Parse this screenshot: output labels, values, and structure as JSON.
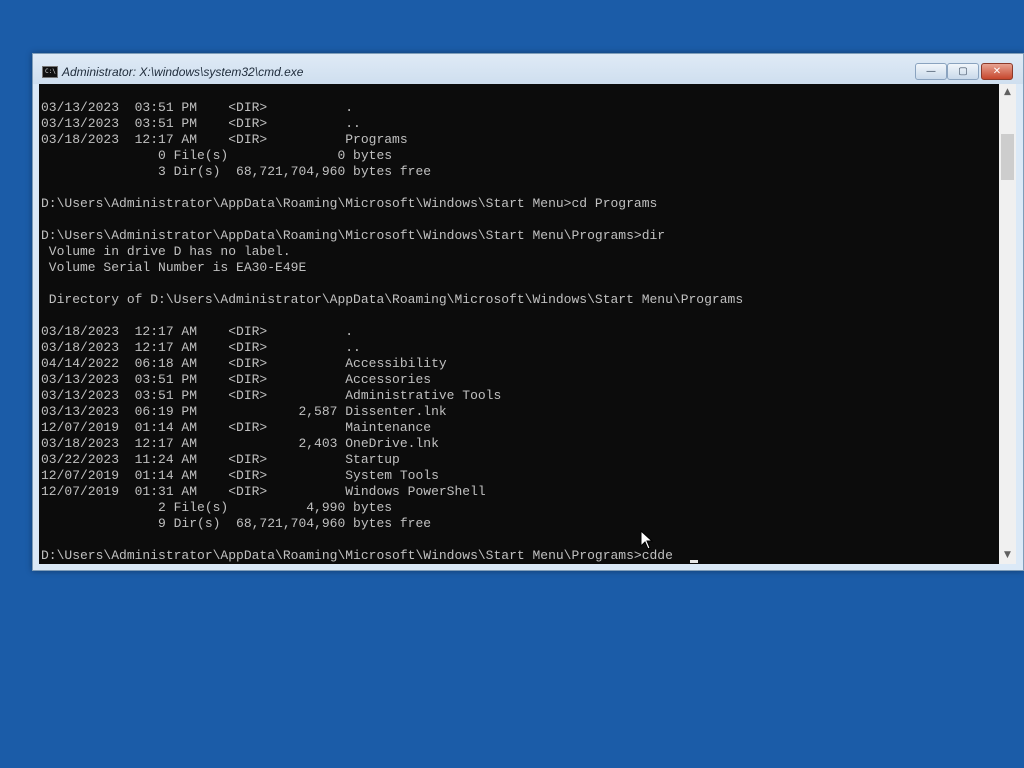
{
  "window": {
    "title": "Administrator: X:\\windows\\system32\\cmd.exe",
    "app_icon_glyph": "C:\\",
    "controls": {
      "minimize": "—",
      "maximize": "▢",
      "close": "✕"
    }
  },
  "console": {
    "lines": [
      "03/13/2023  03:51 PM    <DIR>          .",
      "03/13/2023  03:51 PM    <DIR>          ..",
      "03/18/2023  12:17 AM    <DIR>          Programs",
      "               0 File(s)              0 bytes",
      "               3 Dir(s)  68,721,704,960 bytes free",
      "",
      "D:\\Users\\Administrator\\AppData\\Roaming\\Microsoft\\Windows\\Start Menu>cd Programs",
      "",
      "D:\\Users\\Administrator\\AppData\\Roaming\\Microsoft\\Windows\\Start Menu\\Programs>dir",
      " Volume in drive D has no label.",
      " Volume Serial Number is EA30-E49E",
      "",
      " Directory of D:\\Users\\Administrator\\AppData\\Roaming\\Microsoft\\Windows\\Start Menu\\Programs",
      "",
      "03/18/2023  12:17 AM    <DIR>          .",
      "03/18/2023  12:17 AM    <DIR>          ..",
      "04/14/2022  06:18 AM    <DIR>          Accessibility",
      "03/13/2023  03:51 PM    <DIR>          Accessories",
      "03/13/2023  03:51 PM    <DIR>          Administrative Tools",
      "03/13/2023  06:19 PM             2,587 Dissenter.lnk",
      "12/07/2019  01:14 AM    <DIR>          Maintenance",
      "03/18/2023  12:17 AM             2,403 OneDrive.lnk",
      "03/22/2023  11:24 AM    <DIR>          Startup",
      "12/07/2019  01:14 AM    <DIR>          System Tools",
      "12/07/2019  01:31 AM    <DIR>          Windows PowerShell",
      "               2 File(s)          4,990 bytes",
      "               9 Dir(s)  68,721,704,960 bytes free",
      "",
      "D:\\Users\\Administrator\\AppData\\Roaming\\Microsoft\\Windows\\Start Menu\\Programs>cdde"
    ]
  },
  "scrollbar": {
    "up_icon": "chevron-up-icon",
    "down_icon": "chevron-down-icon"
  },
  "colors": {
    "desktop": "#1b5ca8",
    "console_bg": "#0c0c0c",
    "console_text": "#c0c0c0",
    "close_button": "#c6472d"
  }
}
